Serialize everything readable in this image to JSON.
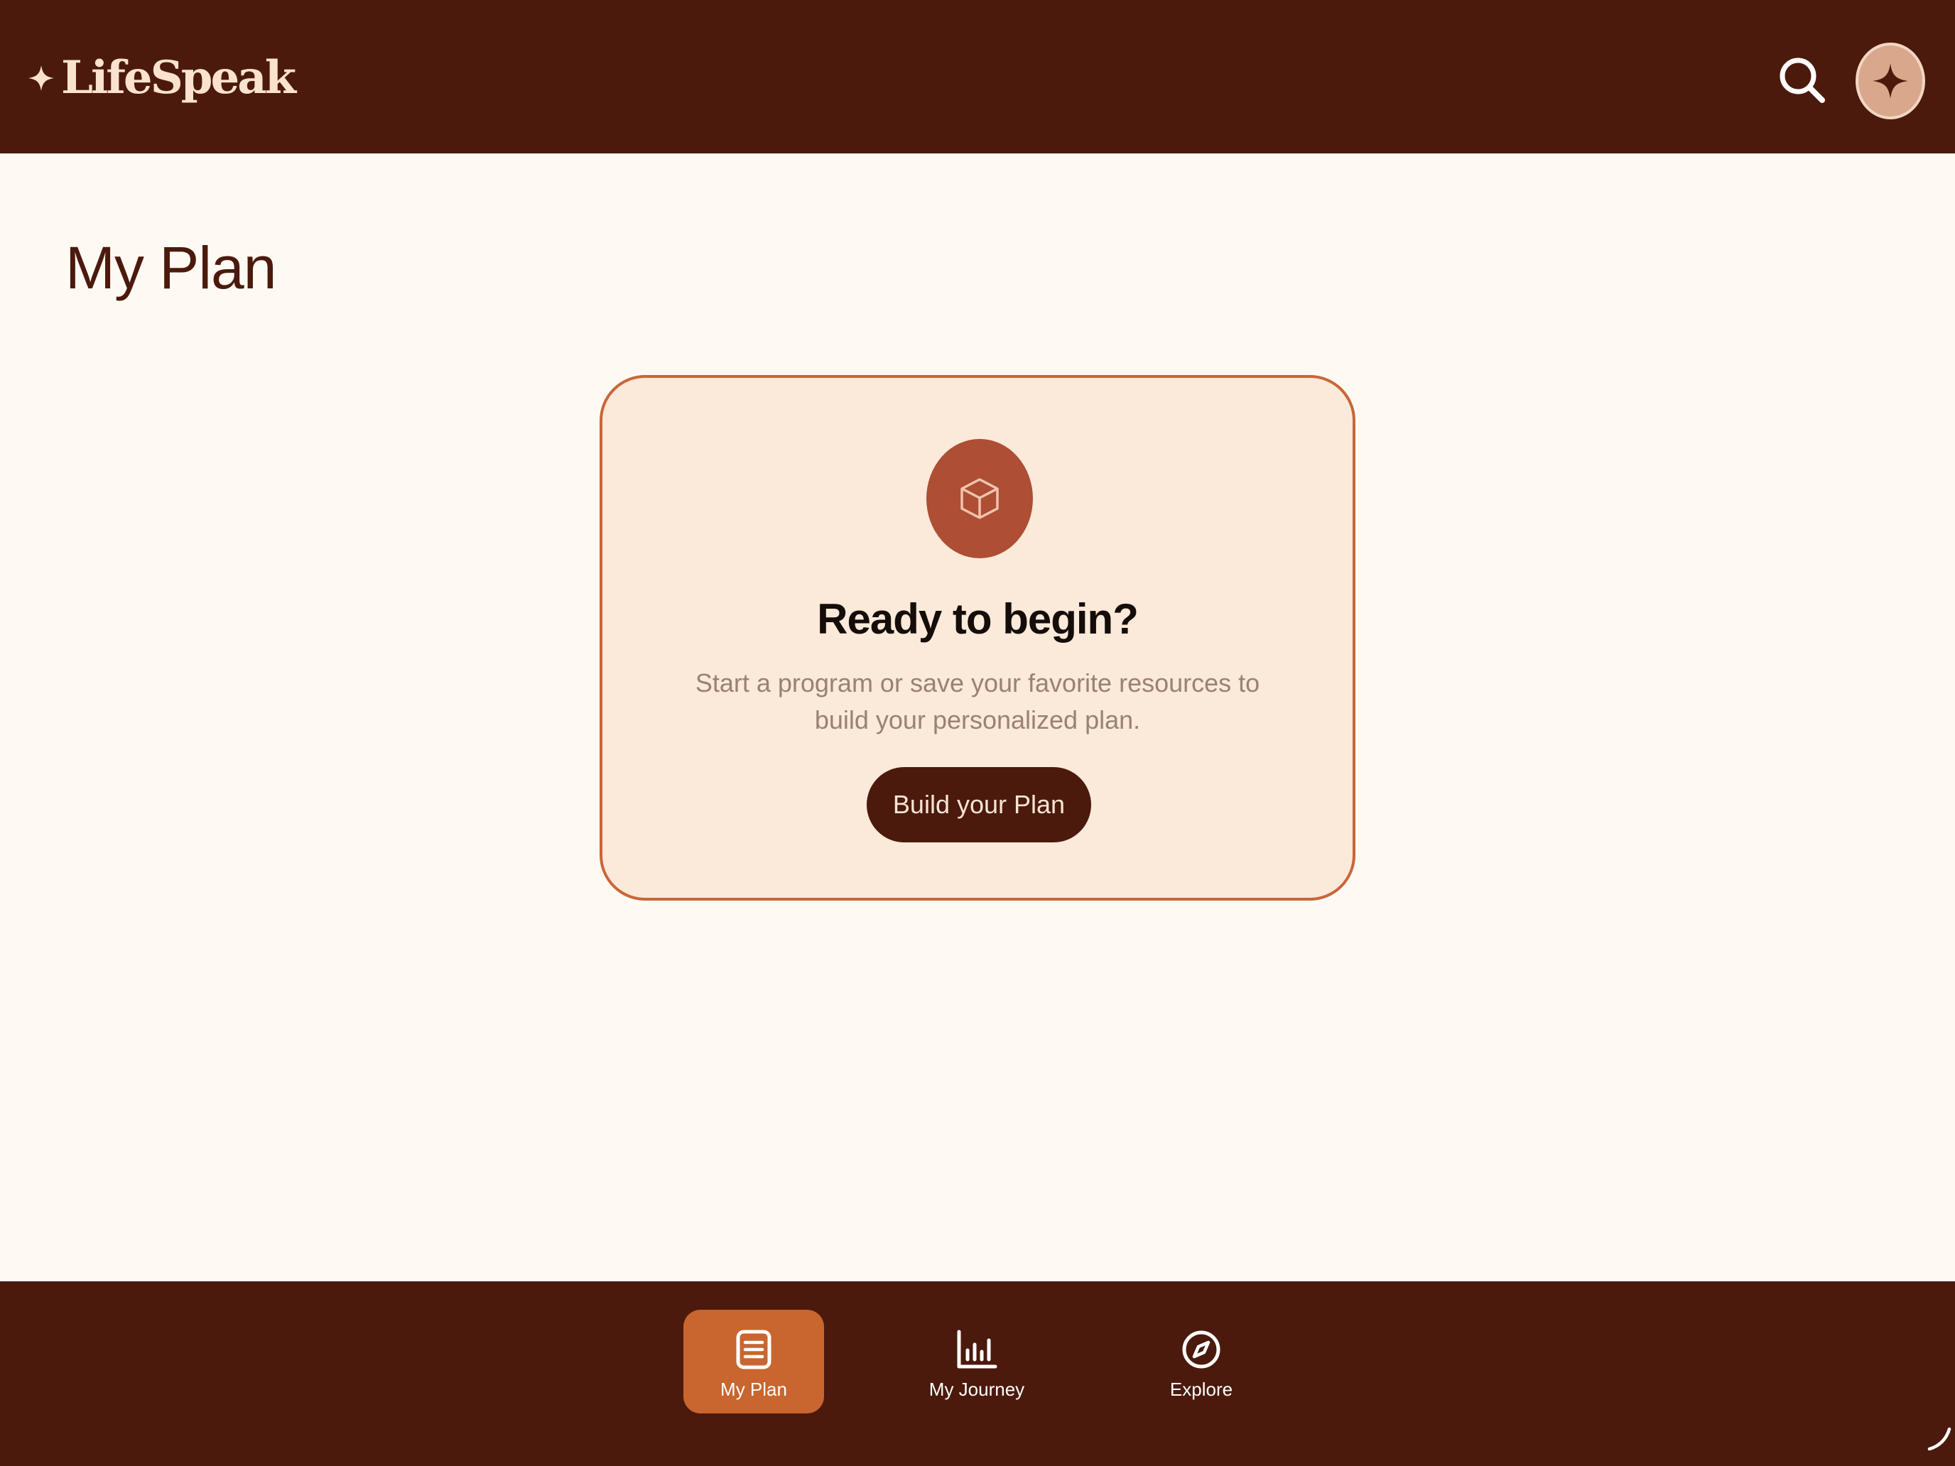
{
  "header": {
    "brand": "LifeSpeak",
    "search_icon": "search-icon",
    "avatar_icon": "sparkle-icon"
  },
  "page": {
    "title": "My Plan"
  },
  "card": {
    "icon": "cube-icon",
    "title": "Ready to begin?",
    "description": "Start a program or save your favorite resources to build your personalized plan.",
    "button_label": "Build your Plan"
  },
  "bottom_nav": {
    "items": [
      {
        "label": "My Plan",
        "icon": "document-list-icon",
        "active": true
      },
      {
        "label": "My Journey",
        "icon": "bar-chart-icon",
        "active": false
      },
      {
        "label": "Explore",
        "icon": "compass-icon",
        "active": false
      }
    ]
  },
  "colors": {
    "brand_dark": "#4b1a0d",
    "accent": "#c9652f",
    "card_background": "#fbe9d9",
    "card_border": "#c9663a",
    "page_background": "#fefaf3",
    "icon_circle": "#ad4e35"
  }
}
